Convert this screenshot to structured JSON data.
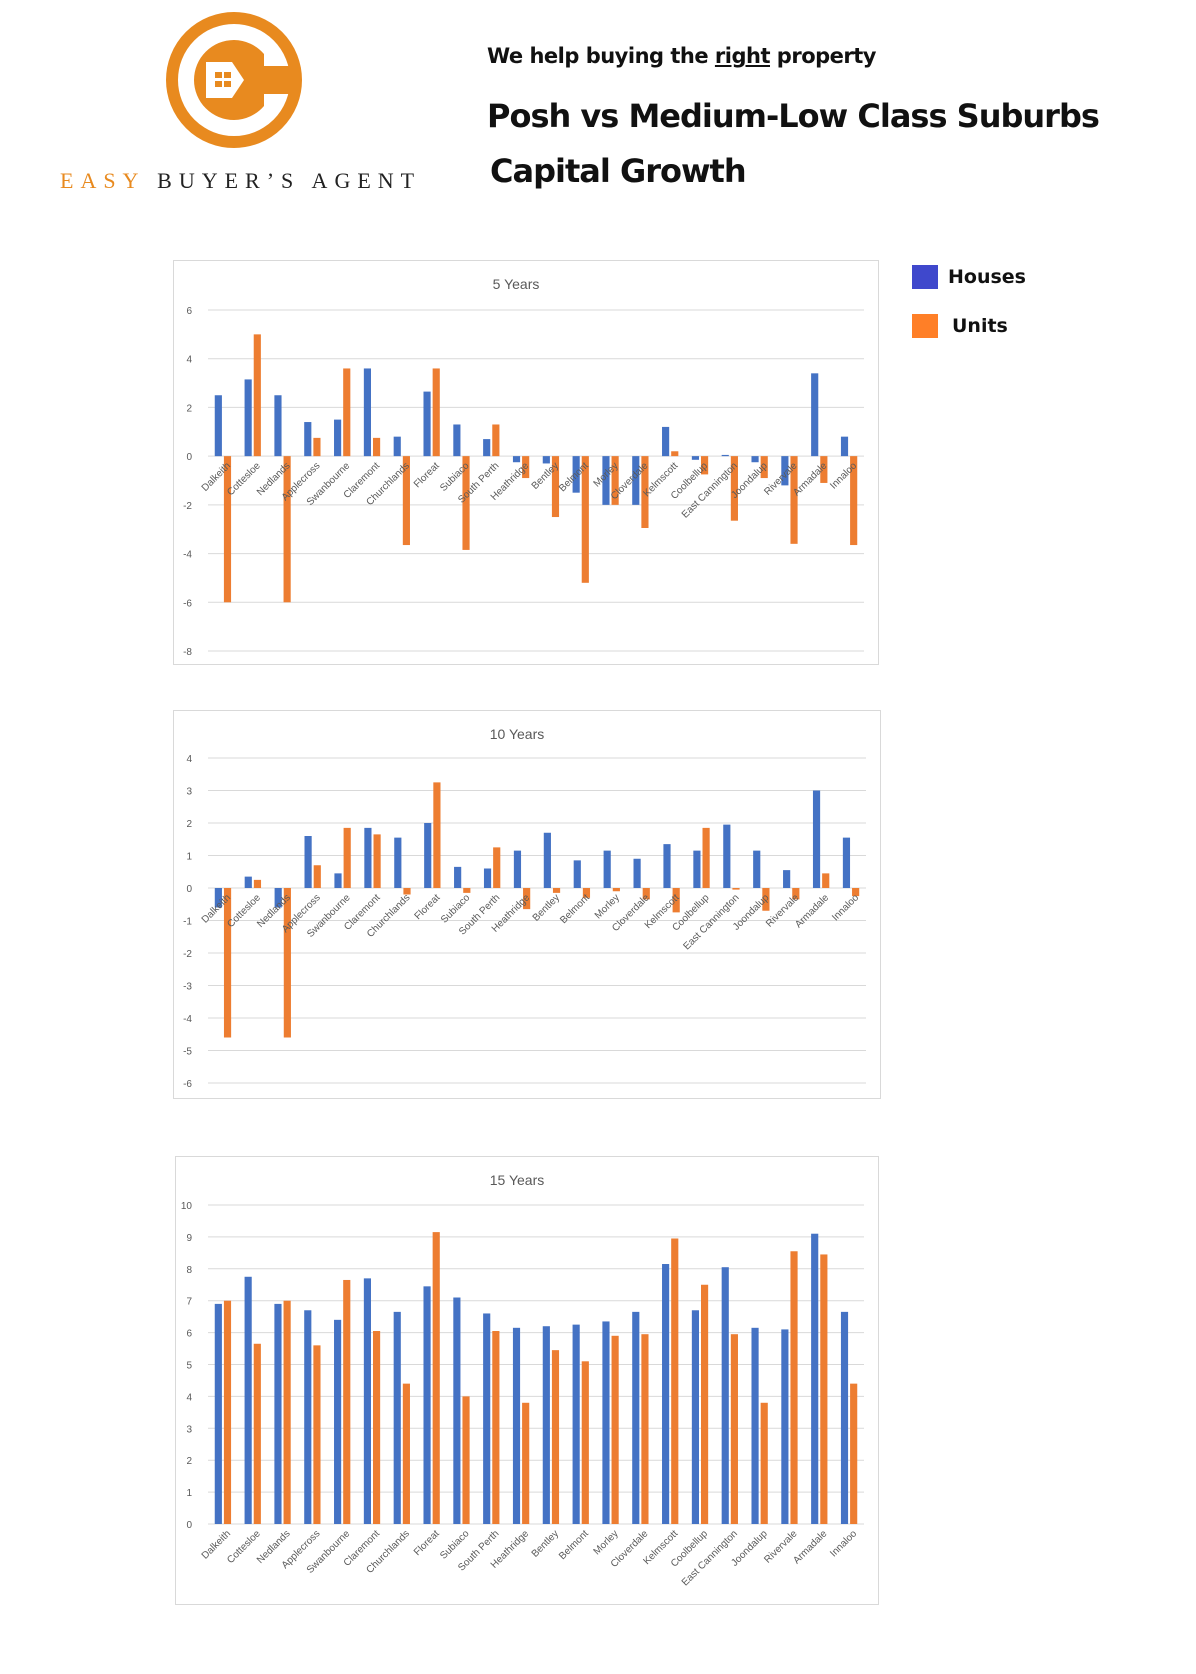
{
  "header": {
    "brand_part1": "EASY",
    "brand_part2": "BUYER’S AGENT",
    "tagline_before": "We help buying the ",
    "tagline_emphasis": "right",
    "tagline_after": " property",
    "title_line1": "Posh vs Medium-Low Class Suburbs",
    "title_line2": "Capital Growth"
  },
  "logo": {
    "icon": "wrench-house-icon",
    "color": "#e88a1f"
  },
  "legend": {
    "items": [
      {
        "label": "Houses",
        "color": "#3f48cc"
      },
      {
        "label": "Units",
        "color": "#ff7f27"
      }
    ]
  },
  "colors": {
    "houses_bar": "#4472c4",
    "units_bar": "#ed7d31"
  },
  "chart_data": [
    {
      "type": "bar",
      "title": "5 Years",
      "xlabel": "",
      "ylabel": "",
      "ylim": [
        -8,
        6
      ],
      "yticks": [
        6,
        4,
        2,
        0,
        -2,
        -4,
        -6,
        -8
      ],
      "grid": true,
      "categories": [
        "Dalkeith",
        "Cottesloe",
        "Nedlands",
        "Applecross",
        "Swanbourne",
        "Claremont",
        "Churchlands",
        "Floreat",
        "Subiaco",
        "South Perth",
        "Heathridge",
        "Bentley",
        "Belmont",
        "Morley",
        "Cloverdale",
        "Kelmscott",
        "Coolbellup",
        "East Cannington",
        "Joondalup",
        "Rivervale",
        "Armadale",
        "Innaloo"
      ],
      "series": [
        {
          "name": "Houses",
          "values": [
            2.5,
            3.15,
            2.5,
            1.4,
            1.5,
            3.6,
            0.8,
            2.65,
            1.3,
            0.7,
            -0.25,
            -0.3,
            -1.5,
            -2.0,
            -2.0,
            1.2,
            -0.15,
            0.05,
            -0.25,
            -1.2,
            3.4,
            0.8
          ]
        },
        {
          "name": "Units",
          "values": [
            -6.0,
            5.0,
            -6.0,
            0.75,
            3.6,
            0.75,
            -3.65,
            3.6,
            -3.85,
            1.3,
            -0.9,
            -2.5,
            -5.2,
            -2.0,
            -2.95,
            0.2,
            -0.75,
            -2.65,
            -0.9,
            -3.6,
            -1.1,
            -3.65
          ]
        }
      ]
    },
    {
      "type": "bar",
      "title": "10 Years",
      "xlabel": "",
      "ylabel": "",
      "ylim": [
        -6,
        4
      ],
      "yticks": [
        4,
        3,
        2,
        1,
        0,
        -1,
        -2,
        -3,
        -4,
        -5,
        -6
      ],
      "grid": true,
      "categories": [
        "Dalkeith",
        "Cottesloe",
        "Nedlands",
        "Applecross",
        "Swanbourne",
        "Claremont",
        "Churchlands",
        "Floreat",
        "Subiaco",
        "South Perth",
        "Heathridge",
        "Bentley",
        "Belmont",
        "Morley",
        "Cloverdale",
        "Kelmscott",
        "Coolbellup",
        "East Cannington",
        "Joondalup",
        "Rivervale",
        "Armadale",
        "Innaloo"
      ],
      "series": [
        {
          "name": "Houses",
          "values": [
            -0.6,
            0.35,
            -0.6,
            1.6,
            0.45,
            1.85,
            1.55,
            2.0,
            0.65,
            0.6,
            1.15,
            1.7,
            0.85,
            1.15,
            0.9,
            1.35,
            1.15,
            1.95,
            1.15,
            0.55,
            3.0,
            1.55
          ]
        },
        {
          "name": "Units",
          "values": [
            -4.6,
            0.25,
            -4.6,
            0.7,
            1.85,
            1.65,
            -0.2,
            3.25,
            -0.15,
            1.25,
            -0.65,
            -0.15,
            -0.3,
            -0.1,
            -0.35,
            -0.75,
            1.85,
            -0.05,
            -0.7,
            -0.35,
            0.45,
            -0.25
          ]
        }
      ]
    },
    {
      "type": "bar",
      "title": "15 Years",
      "xlabel": "",
      "ylabel": "",
      "ylim": [
        0,
        10
      ],
      "yticks": [
        10,
        9,
        8,
        7,
        6,
        5,
        4,
        3,
        2,
        1,
        0
      ],
      "grid": true,
      "categories": [
        "Dalkeith",
        "Cottesloe",
        "Nedlands",
        "Applecross",
        "Swanbourne",
        "Claremont",
        "Churchlands",
        "Floreat",
        "Subiaco",
        "South Perth",
        "Heathridge",
        "Bentley",
        "Belmont",
        "Morley",
        "Cloverdale",
        "Kelmscott",
        "Coolbellup",
        "East Cannington",
        "Joondalup",
        "Rivervale",
        "Armadale",
        "Innaloo"
      ],
      "series": [
        {
          "name": "Houses",
          "values": [
            6.9,
            7.75,
            6.9,
            6.7,
            6.4,
            7.7,
            6.65,
            7.45,
            7.1,
            6.6,
            6.15,
            6.2,
            6.25,
            6.35,
            6.65,
            8.15,
            6.7,
            8.05,
            6.15,
            6.1,
            9.1,
            6.65
          ]
        },
        {
          "name": "Units",
          "values": [
            7.0,
            5.65,
            7.0,
            5.6,
            7.65,
            6.05,
            4.4,
            9.15,
            4.0,
            6.05,
            3.8,
            5.45,
            5.1,
            5.9,
            5.95,
            8.95,
            7.5,
            5.95,
            3.8,
            8.55,
            8.45,
            4.4
          ]
        }
      ]
    }
  ]
}
